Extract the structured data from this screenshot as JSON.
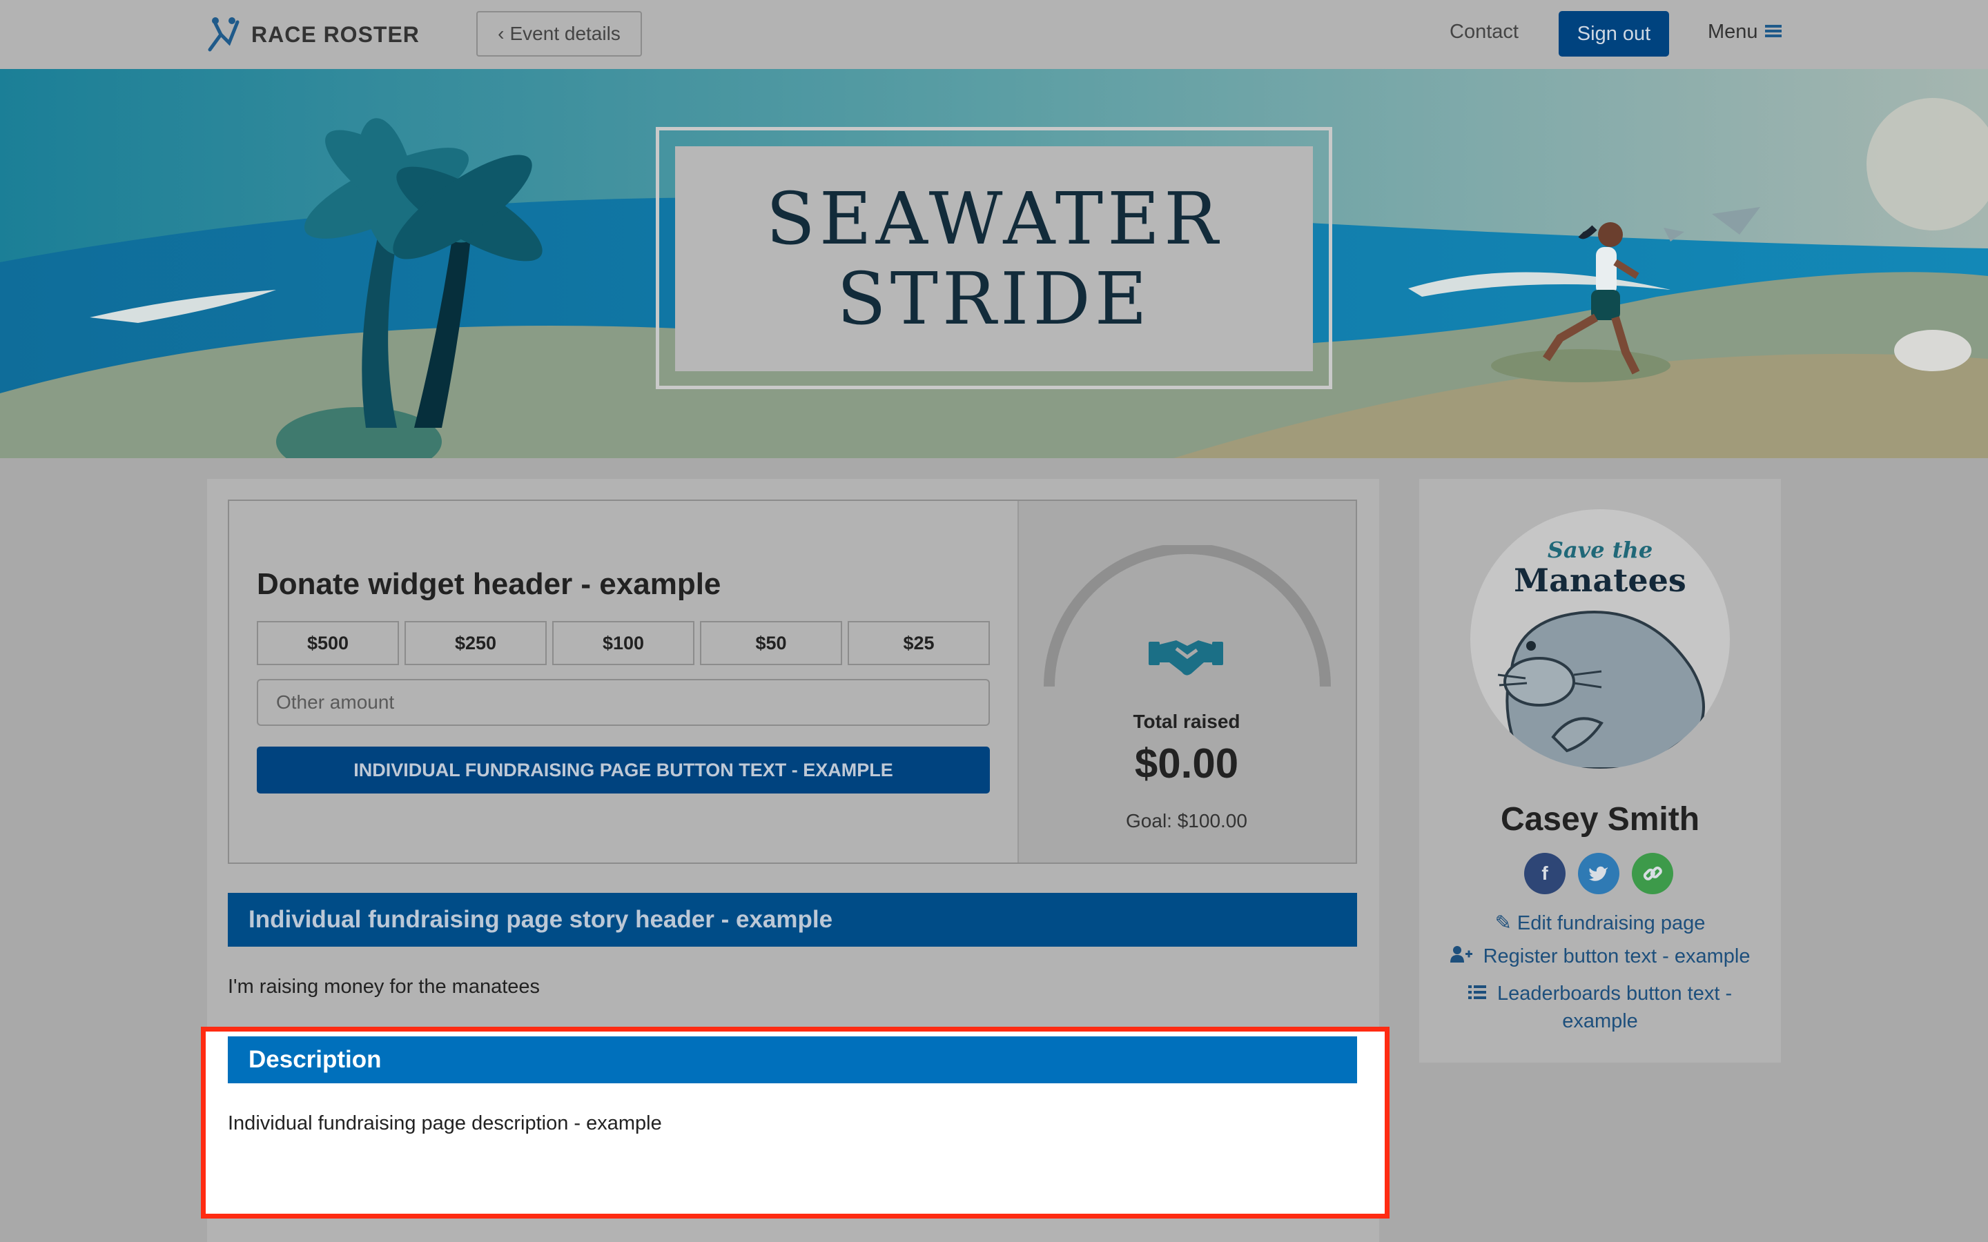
{
  "nav": {
    "brand": "RACE ROSTER",
    "back_label": "Event details",
    "contact": "Contact",
    "sign_out": "Sign out",
    "menu": "Menu"
  },
  "hero": {
    "title_line1": "SEAWATER",
    "title_line2": "STRIDE"
  },
  "donate": {
    "header": "Donate widget header - example",
    "amounts": [
      "$500",
      "$250",
      "$100",
      "$50",
      "$25"
    ],
    "other_placeholder": "Other amount",
    "button": "INDIVIDUAL FUNDRAISING PAGE BUTTON TEXT - EXAMPLE",
    "total_label": "Total raised",
    "total_amount": "$0.00",
    "goal": "Goal: $100.00",
    "progress": 0
  },
  "story": {
    "header": "Individual fundraising page story header - example",
    "text": "I'm raising money for the manatees"
  },
  "description": {
    "header": "Description",
    "text": "Individual fundraising page description - example"
  },
  "profile": {
    "avatar_line1": "Save the",
    "avatar_line2": "Manatees",
    "name": "Casey Smith",
    "socials": [
      "facebook-icon",
      "twitter-icon",
      "link-icon"
    ],
    "edit": "Edit fundraising page",
    "register": "Register button text - example",
    "leaderboards_line1": "Leaderboards button text -",
    "leaderboards_line2": "example"
  },
  "colors": {
    "primary": "#00437f",
    "highlight": "#ff2b12",
    "description_bar": "#0070bc"
  }
}
